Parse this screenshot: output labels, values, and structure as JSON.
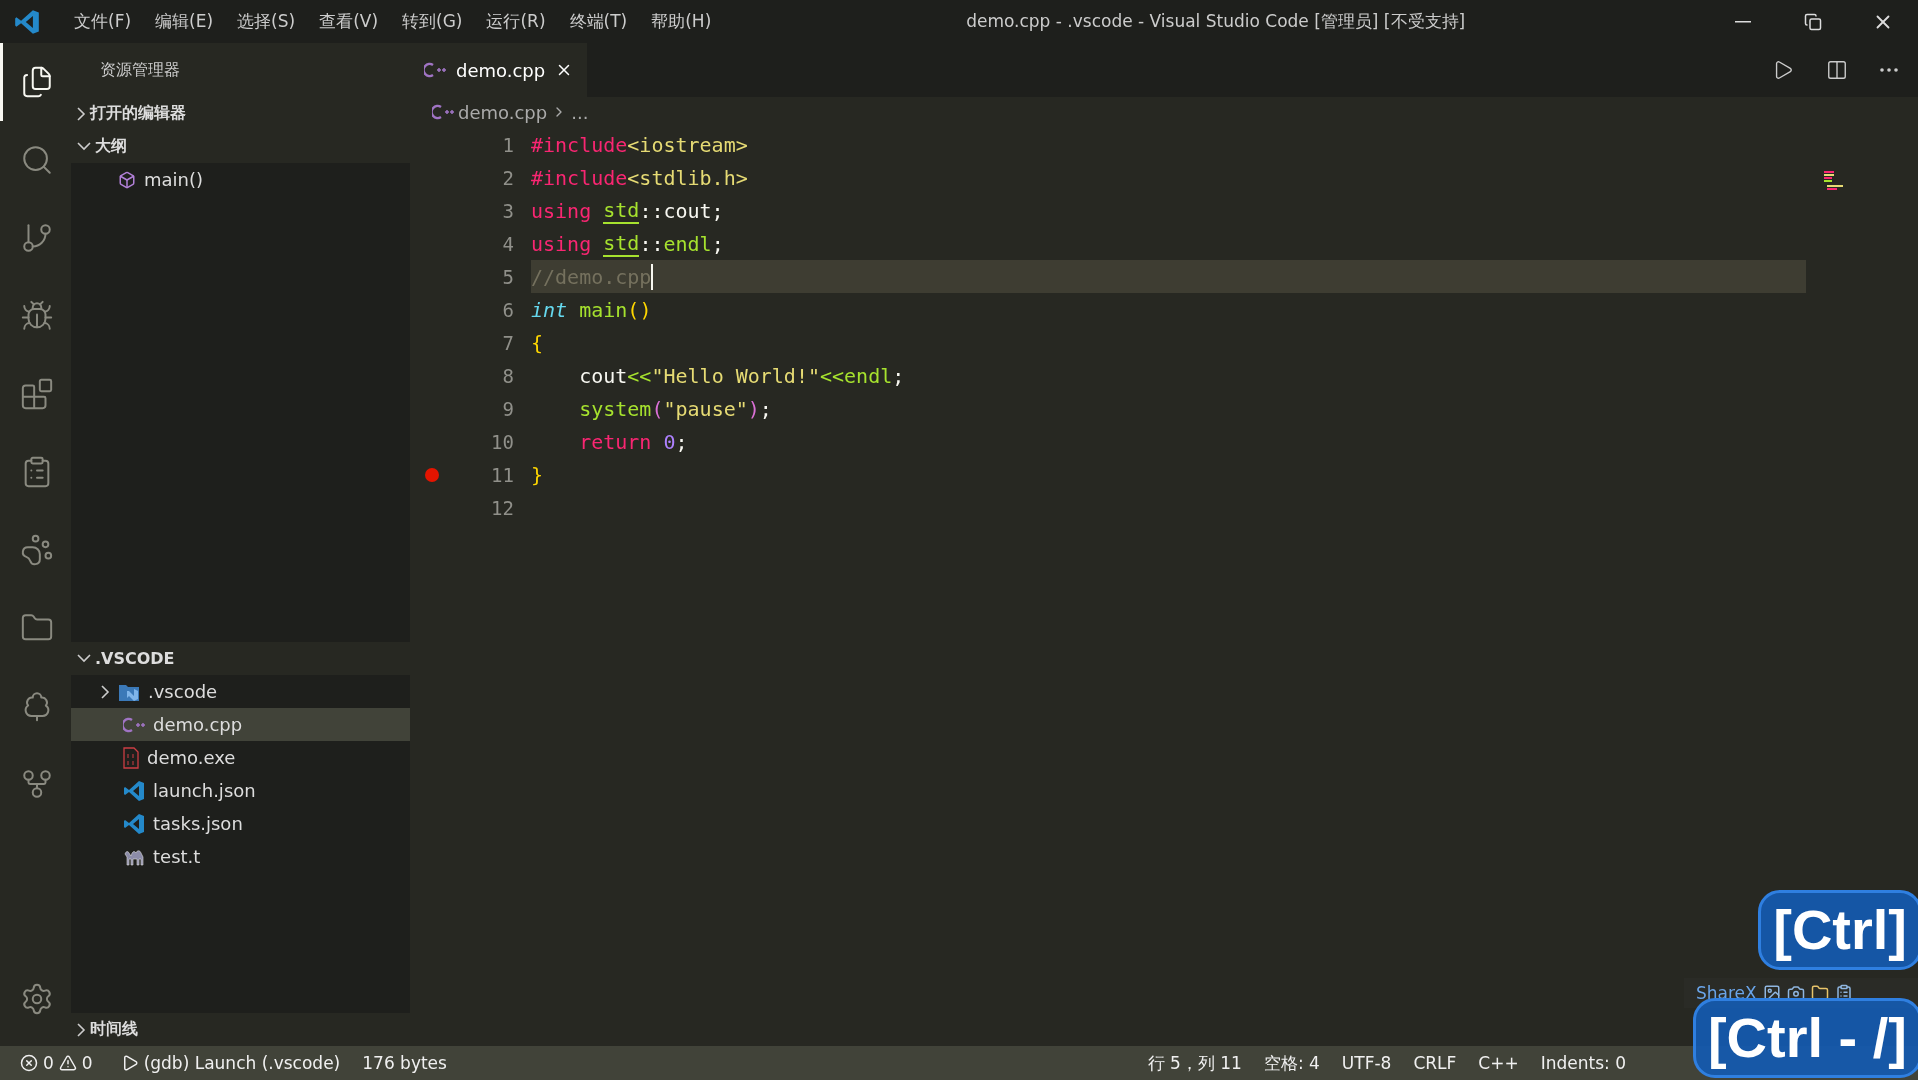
{
  "window": {
    "title": "demo.cpp - .vscode - Visual Studio Code [管理员] [不受支持]"
  },
  "menu": [
    "文件(F)",
    "编辑(E)",
    "选择(S)",
    "查看(V)",
    "转到(G)",
    "运行(R)",
    "终端(T)",
    "帮助(H)"
  ],
  "activity_bar": [
    {
      "kind": "files",
      "selected": true
    },
    {
      "kind": "search",
      "selected": false
    },
    {
      "kind": "git",
      "selected": false
    },
    {
      "kind": "debug",
      "selected": false
    },
    {
      "kind": "extensions",
      "selected": false
    },
    {
      "kind": "clipboard",
      "selected": false
    },
    {
      "kind": "paw",
      "selected": false
    },
    {
      "kind": "folder",
      "selected": false
    },
    {
      "kind": "tree",
      "selected": false
    },
    {
      "kind": "graph",
      "selected": false
    }
  ],
  "sidebar": {
    "title": "资源管理器",
    "sections": [
      {
        "title": "打开的编辑器",
        "expanded": false
      },
      {
        "title": "大纲",
        "expanded": true,
        "outline": [
          {
            "label": "main()"
          }
        ]
      },
      {
        "title": ".VSCODE",
        "expanded": true,
        "files": [
          {
            "label": ".vscode",
            "kind": "vsfolder",
            "selected": false,
            "expanded": false
          },
          {
            "label": "demo.cpp",
            "kind": "cpp",
            "selected": true
          },
          {
            "label": "demo.exe",
            "kind": "exe",
            "selected": false
          },
          {
            "label": "launch.json",
            "kind": "vscode",
            "selected": false
          },
          {
            "label": "tasks.json",
            "kind": "vscode",
            "selected": false
          },
          {
            "label": "test.t",
            "kind": "perl",
            "selected": false
          }
        ]
      }
    ],
    "timeline": {
      "title": "时间线",
      "expanded": false
    }
  },
  "tabs": [
    {
      "label": "demo.cpp",
      "selected": true
    }
  ],
  "breadcrumb": [
    "demo.cpp",
    "..."
  ],
  "code": [
    {
      "n": "1",
      "tokens": [
        {
          "t": "#include",
          "kind": "directive"
        },
        {
          "t": "<iostream>",
          "kind": "header"
        }
      ]
    },
    {
      "n": "2",
      "tokens": [
        {
          "t": "#include",
          "kind": "directive"
        },
        {
          "t": "<stdlib.h>",
          "kind": "header"
        }
      ]
    },
    {
      "n": "3",
      "tokens": [
        {
          "t": "using ",
          "kind": "keyword"
        },
        {
          "t": "std",
          "kind": "ns"
        },
        {
          "t": "::cout;",
          "kind": "plain"
        }
      ]
    },
    {
      "n": "4",
      "tokens": [
        {
          "t": "using ",
          "kind": "keyword"
        },
        {
          "t": "std",
          "kind": "ns"
        },
        {
          "t": "::",
          "kind": "plain"
        },
        {
          "t": "endl",
          "kind": "func"
        },
        {
          "t": ";",
          "kind": "plain"
        }
      ]
    },
    {
      "n": "5",
      "current": true,
      "tokens": [
        {
          "t": "//demo.cpp",
          "kind": "comment"
        }
      ]
    },
    {
      "n": "6",
      "tokens": [
        {
          "t": "int",
          "kind": "type"
        },
        {
          "t": " main",
          "kind": "func"
        },
        {
          "t": "()",
          "kind": "brace"
        }
      ]
    },
    {
      "n": "7",
      "tokens": [
        {
          "t": "{",
          "kind": "brace"
        }
      ]
    },
    {
      "n": "8",
      "tokens": [
        {
          "t": "    cout",
          "kind": "plain"
        },
        {
          "t": "<<",
          "kind": "func"
        },
        {
          "t": "\"Hello World!\"",
          "kind": "header"
        },
        {
          "t": "<<endl",
          "kind": "func"
        },
        {
          "t": ";",
          "kind": "plain"
        }
      ]
    },
    {
      "n": "9",
      "tokens": [
        {
          "t": "    system",
          "kind": "func"
        },
        {
          "t": "(",
          "kind": "paren"
        },
        {
          "t": "\"pause\"",
          "kind": "header"
        },
        {
          "t": ")",
          "kind": "paren"
        },
        {
          "t": ";",
          "kind": "plain"
        }
      ]
    },
    {
      "n": "10",
      "tokens": [
        {
          "t": "    return ",
          "kind": "keyword"
        },
        {
          "t": "0",
          "kind": "number"
        },
        {
          "t": ";",
          "kind": "plain"
        }
      ]
    },
    {
      "n": "11",
      "breakpoint": true,
      "tokens": [
        {
          "t": "}",
          "kind": "brace"
        }
      ]
    },
    {
      "n": "12"
    }
  ],
  "status_bar": {
    "errors": "0",
    "warnings": "0",
    "launch": "(gdb) Launch (.vscode)",
    "size": "176 bytes",
    "right": [
      "行 5，列 11",
      "空格: 4",
      "UTF-8",
      "CRLF",
      "C++",
      "Indents: 0"
    ]
  },
  "overlays": {
    "keys": [
      "[Ctrl]",
      "[Ctrl - /]"
    ],
    "sharex": "ShareX"
  }
}
